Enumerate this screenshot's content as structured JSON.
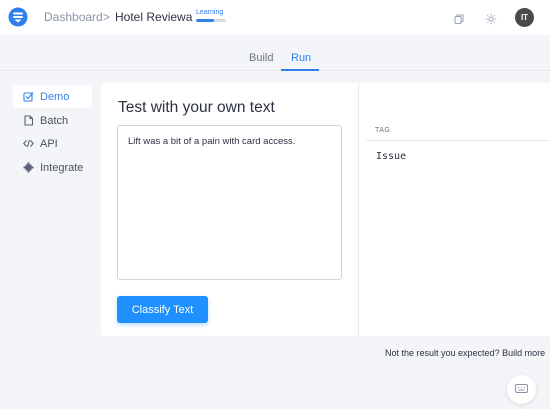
{
  "header": {
    "breadcrumb_root": "Dashboard",
    "breadcrumb_separator": ">",
    "model_name": "Hotel Reviewa",
    "status_label": "Learning",
    "status_progress_percent": 60,
    "avatar_initials": "IT",
    "icons": [
      "logo-icon",
      "copy-icon",
      "gear-icon"
    ]
  },
  "tabs": [
    {
      "label": "Build",
      "active": false
    },
    {
      "label": "Run",
      "active": true
    }
  ],
  "sidebar": {
    "items": [
      {
        "label": "Demo",
        "icon": "checkbox-edit-icon",
        "active": true
      },
      {
        "label": "Batch",
        "icon": "document-icon",
        "active": false
      },
      {
        "label": "API",
        "icon": "code-icon",
        "active": false
      },
      {
        "label": "Integrate",
        "icon": "puzzle-icon",
        "active": false
      }
    ]
  },
  "main": {
    "title": "Test with your own text",
    "input_value": "Lift was a bit of a pain with card access.",
    "classify_button": "Classify Text",
    "results": {
      "column_header": "TAG",
      "tag": "Issue"
    },
    "footnote": "Not the result you expected? Build more"
  },
  "colors": {
    "accent": "#2f80ed",
    "button": "#1e90ff",
    "background": "#f4f5f8"
  }
}
